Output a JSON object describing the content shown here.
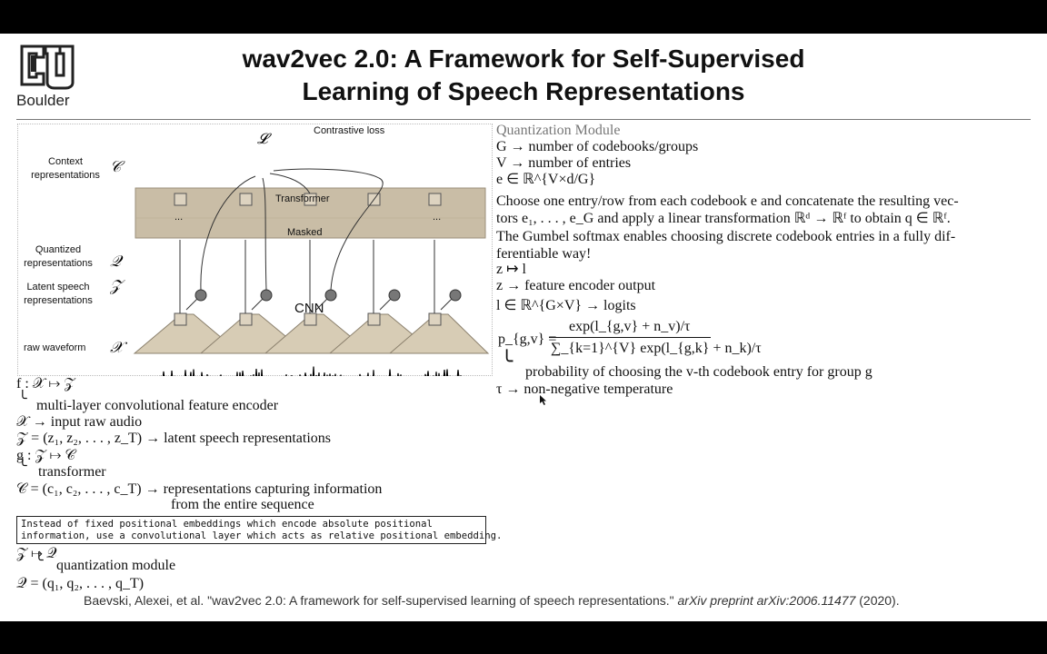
{
  "header": {
    "title_line1": "wav2vec 2.0: A Framework for Self-Supervised",
    "title_line2": "Learning of Speech Representations",
    "logo_text": "Boulder"
  },
  "figure": {
    "contrastive_loss": "Contrastive loss",
    "loss_symbol": "𝓛",
    "context_label": "Context\nrepresentations",
    "context_symbol": "𝒞",
    "transformer_label": "Transformer",
    "dots": "...",
    "masked_label": "Masked",
    "quantized_label": "Quantized\nrepresentations",
    "quantized_symbol": "𝒬",
    "latent_label": "Latent speech\nrepresentations",
    "latent_symbol": "𝒵",
    "cnn_label": "CNN",
    "raw_label": "raw waveform",
    "raw_symbol": "𝒳",
    "q_node": "q"
  },
  "left_notes": {
    "l1": "f : 𝒳 ↦ 𝒵",
    "l2": "multi-layer convolutional feature encoder",
    "l3": "𝒳 → input raw audio",
    "l4": "𝒵 = (z₁, z₂, . . . , z_T) → latent speech representations",
    "l5": "g : 𝒵 ↦ 𝒞",
    "l6": "transformer",
    "l7": "𝒞 = (c₁, c₂, . . . , c_T) → representations capturing information",
    "l8": "from the entire sequence",
    "box_line1": "Instead of fixed positional embeddings which encode absolute positional",
    "box_line2": "information, use a convolutional layer which acts as relative positional embedding.",
    "l9": "𝒵 ↦ 𝒬",
    "l10": "quantization module",
    "l11": "𝒬 = (q₁, q₂, . . . , q_T)"
  },
  "right_notes": {
    "title": "Quantization Module",
    "r1": "G → number of codebooks/groups",
    "r2": "V → number of entries",
    "r3": "e ∈ ℝ^{V×d/G}",
    "p1_line1": "Choose one entry/row from each codebook e and concatenate the resulting vec-",
    "p1_line2": "tors e₁, . . . , e_G and apply a linear transformation ℝᵈ → ℝᶠ to obtain q ∈ ℝᶠ.",
    "p2_line1": "The Gumbel softmax enables choosing discrete codebook entries in a fully dif-",
    "p2_line2": "ferentiable way!",
    "r4": "z ↦ l",
    "r5": "z → feature encoder output",
    "r6": "l ∈ ℝ^{G×V} → logits",
    "pgv": "p_{g,v} =",
    "numerator": "exp(l_{g,v} + n_v)/τ",
    "denominator": "∑_{k=1}^{V} exp(l_{g,k} + n_k)/τ",
    "r7": "probability of choosing the v-th codebook entry for group g",
    "r8": "τ → non-negative temperature"
  },
  "citation": {
    "plain": "Baevski, Alexei, et al. \"wav2vec 2.0: A framework for self-supervised learning of speech representations.\"",
    "italic": "arXiv preprint arXiv:2006.11477",
    "year": "(2020)."
  },
  "colors": {
    "background": "#ffffff",
    "frame": "#000000",
    "transformer_fill": "#c9bda6",
    "cnn_fill": "#d7ccb5",
    "node_fill": "#ddd3c0",
    "q_node_fill": "#777777",
    "waveform": "#000000",
    "muted_title": "#777777"
  }
}
